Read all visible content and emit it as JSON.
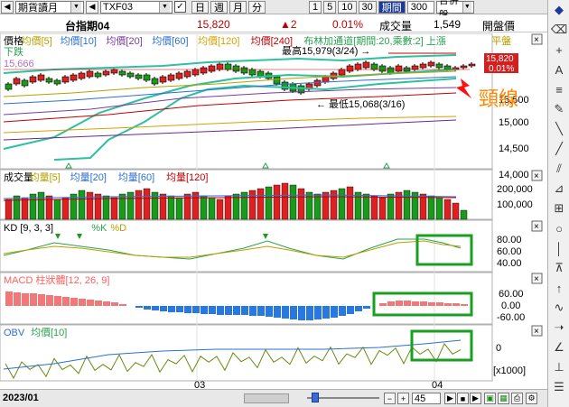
{
  "toolbar": {
    "product": "期貨讀月",
    "symbol": "TXF03",
    "periods": [
      "日",
      "週",
      "月",
      "分"
    ],
    "intervals": [
      "1",
      "5",
      "10",
      "30"
    ],
    "active_period": "期間",
    "bars": "300",
    "merge": "合併盤"
  },
  "quote": {
    "name": "台指期04",
    "price": "15,820",
    "change": "▲2",
    "change_pct": "0.01%",
    "volume_label": "成交量",
    "volume": "1,549",
    "open_label": "開盤價"
  },
  "main_panel": {
    "legend": [
      {
        "label": "價格",
        "color": "#000000"
      },
      {
        "label": "均價[5]",
        "color": "#b8a000"
      },
      {
        "label": "均價[10]",
        "color": "#2b6fd6"
      },
      {
        "label": "均價[20]",
        "color": "#7a3aa0"
      },
      {
        "label": "均價[60]",
        "color": "#2b6fd6"
      },
      {
        "label": "均價[120]",
        "color": "#d8a000"
      },
      {
        "label": "均價[240]",
        "color": "#c00000"
      },
      {
        "label": "布林加通道[期間:20,乘數:2] 上漲",
        "color": "#2aa050"
      },
      {
        "label": "平盤",
        "color": "#b8a000"
      }
    ],
    "legend_down": "下跌",
    "ref_value": "15,666",
    "high_label": "最高15,979(3/24)",
    "low_label": "最低15,068(3/16)",
    "price_tag": "15,820",
    "pct_tag": "0.01%",
    "y_ticks": [
      "15,500",
      "15,000",
      "14,500",
      "14,000"
    ],
    "annotation": "頸線",
    "annotation_color": "#ff8800"
  },
  "volume_panel": {
    "legend": [
      {
        "label": "成交量",
        "color": "#000000"
      },
      {
        "label": "均量[5]",
        "color": "#b8a000"
      },
      {
        "label": "均量[20]",
        "color": "#2b6fd6"
      },
      {
        "label": "均量[60]",
        "color": "#2b6fd6"
      },
      {
        "label": "均量[120]",
        "color": "#c00000"
      }
    ],
    "y_ticks": [
      "200,000",
      "100,000"
    ]
  },
  "kd_panel": {
    "legend": [
      {
        "label": "KD [9, 3, 3]",
        "color": "#000000"
      },
      {
        "label": "%K",
        "color": "#2aa050"
      },
      {
        "label": "%D",
        "color": "#b8a000"
      }
    ],
    "y_ticks": [
      "80.00",
      "60.00",
      "40.00"
    ]
  },
  "macd_panel": {
    "legend_label": "MACD 柱狀體[12, 26, 9]",
    "legend_color": "#ff6060",
    "y_ticks": [
      "60.00",
      "0.00",
      "-60.00"
    ]
  },
  "obv_panel": {
    "legend": [
      {
        "label": "OBV",
        "color": "#2b6fd6"
      },
      {
        "label": "均價[10]",
        "color": "#2aa050"
      }
    ],
    "y_tick": "0",
    "unit": "[x1000]"
  },
  "time_axis": {
    "start": "2023/01",
    "mid": "03",
    "end": "04"
  },
  "statusbar": {
    "zoom_value": "45"
  },
  "chart_data": {
    "type": "candlestick",
    "panels": [
      "price",
      "volume",
      "kd",
      "macd",
      "obv"
    ],
    "last_price": 15820,
    "high": {
      "value": 15979,
      "date": "3/24"
    },
    "low": {
      "value": 15068,
      "date": "3/16"
    },
    "x_ticks": [
      "2023/01",
      "03",
      "04"
    ],
    "price_y_ticks": [
      15500,
      15000,
      14500,
      14000
    ],
    "volume_y_ticks": [
      200000,
      100000
    ],
    "kd_y_ticks": [
      80,
      60,
      40
    ],
    "macd_y_ticks": [
      60,
      0,
      -60
    ]
  }
}
